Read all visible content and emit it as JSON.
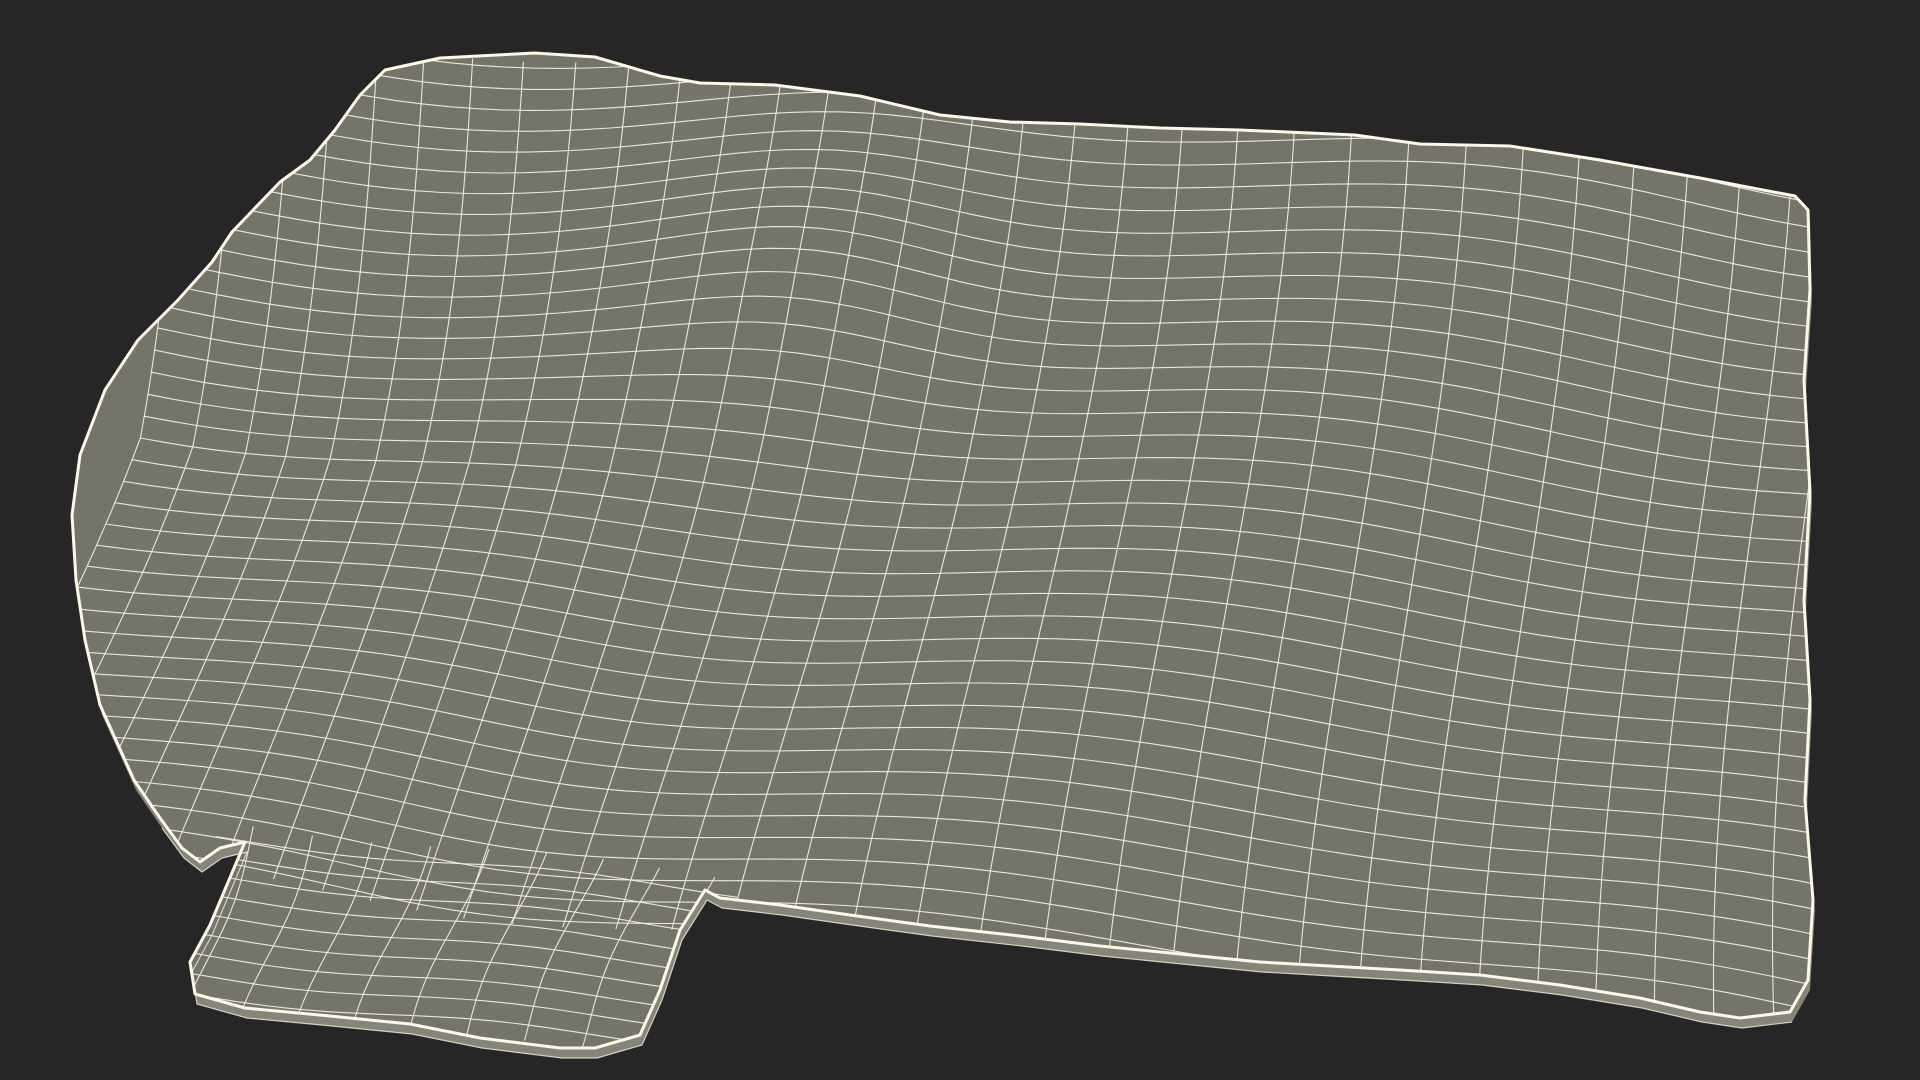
{
  "scene": {
    "background_color": "#262626",
    "mesh_fill_color": "#74746b",
    "mesh_side_color": "#85857b",
    "wire_color": "#f4f2e6",
    "mesh_type": "wireframe"
  }
}
